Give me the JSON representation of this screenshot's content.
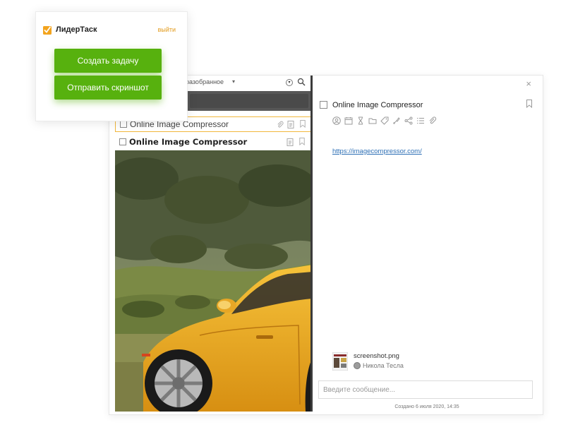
{
  "popup": {
    "app_name": "ЛидерТаск",
    "logout": "выйти",
    "create_task": "Создать задачу",
    "send_screenshot": "Отправить скриншот"
  },
  "window": {
    "close_glyph": "×"
  },
  "task_list": {
    "filter_label": "разобранное",
    "filter_caret": "▾",
    "filter_circle": "▾",
    "rows": [
      {
        "title": "Online Image Compressor"
      },
      {
        "title": "Online Image Compressor"
      }
    ]
  },
  "detail": {
    "title": "Online Image Compressor",
    "toolbar_icons": [
      "user-icon",
      "calendar-icon",
      "hourglass-icon",
      "folder-icon",
      "tag-icon",
      "color-icon",
      "share-icon",
      "checklist-icon",
      "attach-icon"
    ],
    "link": "https://imagecompressor.com/",
    "attachment": {
      "file_name": "screenshot.png",
      "author": "Никола Тесла"
    },
    "message_placeholder": "Введите сообщение...",
    "created": "Создано 6 июля 2020, 14:35"
  },
  "colors": {
    "accent_green": "#57b10e",
    "accent_orange": "#f1b73c",
    "link_blue": "#2d6fb5"
  }
}
